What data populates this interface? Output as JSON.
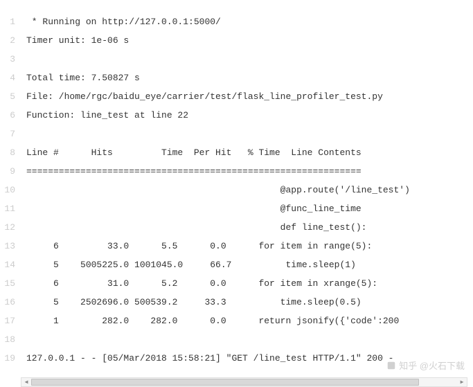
{
  "lines": [
    {
      "num": 1,
      "text": " * Running on http://127.0.0.1:5000/"
    },
    {
      "num": 2,
      "text": "Timer unit: 1e-06 s"
    },
    {
      "num": 3,
      "text": ""
    },
    {
      "num": 4,
      "text": "Total time: 7.50827 s"
    },
    {
      "num": 5,
      "text": "File: /home/rgc/baidu_eye/carrier/test/flask_line_profiler_test.py"
    },
    {
      "num": 6,
      "text": "Function: line_test at line 22"
    },
    {
      "num": 7,
      "text": ""
    },
    {
      "num": 8,
      "text": "Line #      Hits         Time  Per Hit   % Time  Line Contents"
    },
    {
      "num": 9,
      "text": "=============================================================="
    },
    {
      "num": 10,
      "text": "                                               @app.route('/line_test')"
    },
    {
      "num": 11,
      "text": "                                               @func_line_time"
    },
    {
      "num": 12,
      "text": "                                               def line_test():"
    },
    {
      "num": 13,
      "text": "     6         33.0      5.5      0.0      for item in range(5):"
    },
    {
      "num": 14,
      "text": "     5    5005225.0 1001045.0     66.7          time.sleep(1)"
    },
    {
      "num": 15,
      "text": "     6         31.0      5.2      0.0      for item in xrange(5):"
    },
    {
      "num": 16,
      "text": "     5    2502696.0 500539.2     33.3          time.sleep(0.5)"
    },
    {
      "num": 17,
      "text": "     1        282.0    282.0      0.0      return jsonify({'code':200"
    },
    {
      "num": 18,
      "text": ""
    },
    {
      "num": 19,
      "text": "127.0.0.1 - - [05/Mar/2018 15:58:21] \"GET /line_test HTTP/1.1\" 200 -"
    }
  ],
  "scrollbar": {
    "left_arrow": "◀",
    "right_arrow": "▶"
  },
  "watermark": {
    "text": "知乎 @火石下载"
  }
}
